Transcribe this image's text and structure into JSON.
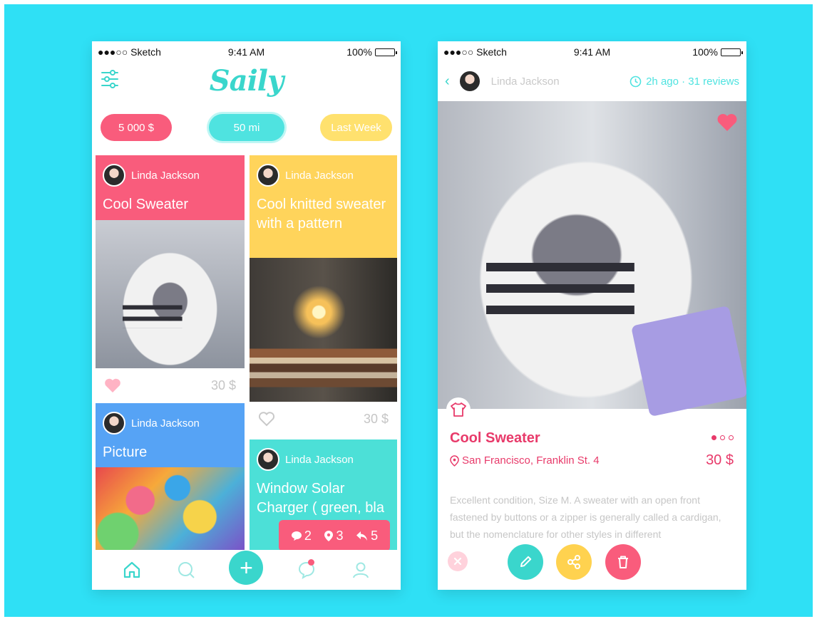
{
  "status_bar": {
    "carrier": "●●●○○ Sketch",
    "time": "9:41 AM",
    "battery": "100%"
  },
  "feed": {
    "logo": "Saily",
    "filters": [
      "5 000 $",
      "50 mi",
      "Last Week"
    ],
    "cards": [
      {
        "author": "Linda Jackson",
        "title": "Cool Sweater",
        "price": "30 $",
        "liked": true
      },
      {
        "author": "Linda Jackson",
        "title": "Cool knitted sweater with a pattern",
        "price": "30 $",
        "liked": false
      },
      {
        "author": "Linda Jackson",
        "title": "Picture"
      },
      {
        "author": "Linda Jackson",
        "title": "Window Solar Charger ( green, bla"
      }
    ],
    "stats": {
      "comments": "2",
      "locations": "3",
      "shares": "5"
    }
  },
  "detail": {
    "author": "Linda Jackson",
    "meta": "2h ago · 31 reviews",
    "title": "Cool Sweater",
    "location": "San Francisco, Franklin St. 4",
    "price": "30 $",
    "description": "Excellent condition, Size M. A sweater with an open front fastened by buttons or a zipper is generally called a cardigan, but the nomenclature for other styles in different"
  },
  "colors": {
    "background": "#2fe0f5",
    "teal": "#3ad6cc",
    "pink": "#f95c7c",
    "yellow": "#ffd45b",
    "blue": "#56a3f5"
  }
}
